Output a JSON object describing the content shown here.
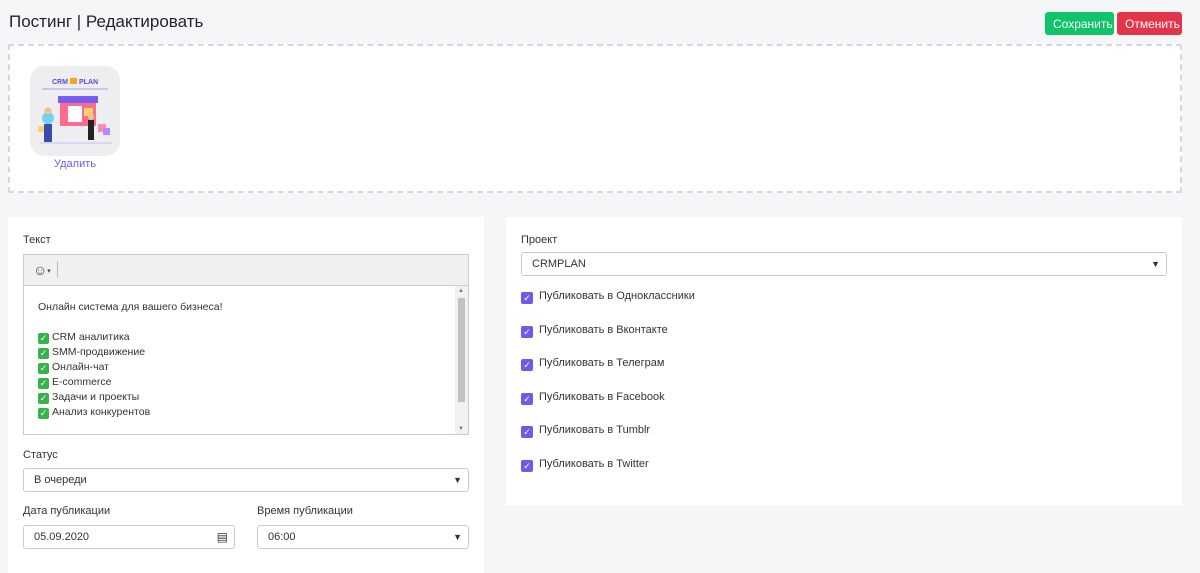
{
  "header": {
    "title": "Постинг | Редактировать",
    "save_label": "Сохранить",
    "cancel_label": "Отменить"
  },
  "upload": {
    "remove_label": "Удалить",
    "logo_text": "CRM PLAN"
  },
  "left": {
    "text_label": "Текст",
    "editor_lines": [
      "Онлайн система для вашего бизнеса!",
      "",
      "CRM аналитика",
      "SMM-продвижение",
      "Онлайн-чат",
      "E-commerce",
      "Задачи и проекты",
      "Анализ конкурентов"
    ],
    "status_label": "Статус",
    "status_value": "В очереди",
    "date_label": "Дата публикации",
    "date_value": "05.09.2020",
    "time_label": "Время публикации",
    "time_value": "06:00"
  },
  "right": {
    "project_label": "Проект",
    "project_value": "CRMPLAN",
    "checkboxes": [
      "Публиковать в Одноклассники",
      "Публиковать в Вконтакте",
      "Публиковать в Телеграм",
      "Публиковать в Facebook",
      "Публиковать в Tumblr",
      "Публиковать в Twitter"
    ]
  },
  "colors": {
    "save": "#10c469",
    "cancel": "#e3344a",
    "accent": "#6c5ce7"
  }
}
